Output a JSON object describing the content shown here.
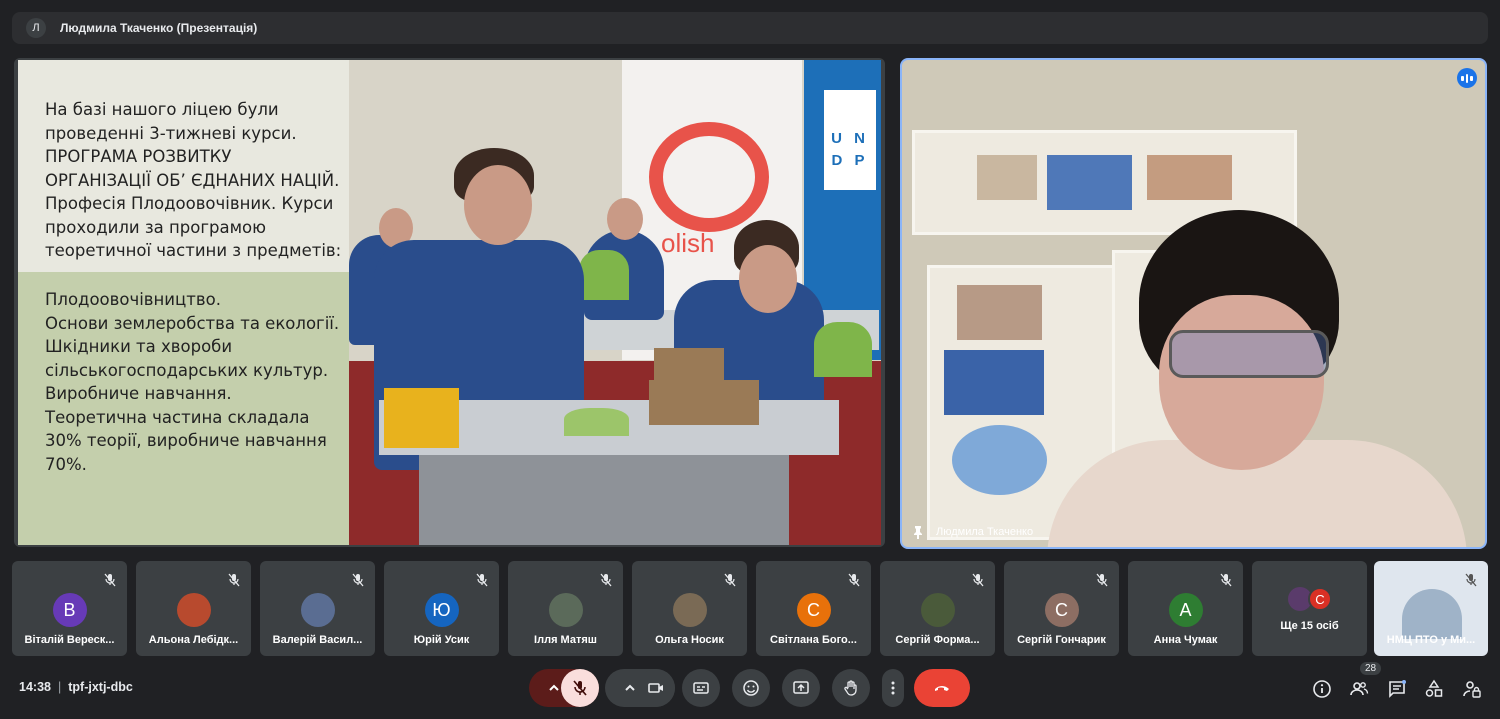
{
  "topbar": {
    "avatar_letter": "Л",
    "title": "Людмила Ткаченко (Презентація)"
  },
  "slide": {
    "text_top": "На базі нашого ліцею були\nпроведенні 3-тижневі  курси.\n      ПРОГРАМА РОЗВИТКУ\nОРГАНІЗАЦІЇ ОБ’ ЄДНАНИХ НАЦІЙ.\nПрофесія Плодоовочівник. Курси\nпроходили за програмою\nтеоретичної частини з предметів:",
    "text_bottom": "Плодоовочівництво.\nОснови землеробства та екології.\nШкідники та хвороби\nсільськогосподарських культур.\nВиробниче навчання.\n Теоретична частина складала\n30% теорії, виробниче навчання\n70%.",
    "photo_text": "olish",
    "undp_text": "U N\nD P"
  },
  "camera": {
    "name": "Людмила Ткаченко",
    "border_color": "#8ab4f8"
  },
  "participants": [
    {
      "name": "Віталій Верескун",
      "display": "Віталій Вереск...",
      "letter": "В",
      "color": "#673ab7"
    },
    {
      "name": "Альона Лебідка",
      "display": "Альона Лебідк...",
      "letter": "",
      "color": "#b84a2e"
    },
    {
      "name": "Валерій Василій",
      "display": "Валерій Васил...",
      "letter": "",
      "color": "#5a6d92"
    },
    {
      "name": "Юрій Усик",
      "display": "Юрій Усик",
      "letter": "Ю",
      "color": "#1565c0"
    },
    {
      "name": "Ілля Матяш",
      "display": "Ілля Матяш",
      "letter": "",
      "color": "#5b6a5a"
    },
    {
      "name": "Ольга Носик",
      "display": "Ольга Носик",
      "letter": "",
      "color": "#7a6a55"
    },
    {
      "name": "Світлана Богомолова",
      "display": "Світлана Бого...",
      "letter": "С",
      "color": "#e8710a"
    },
    {
      "name": "Сергій Формаль",
      "display": "Сергій Форма...",
      "letter": "",
      "color": "#4a5a3a"
    },
    {
      "name": "Сергій Гончарик",
      "display": "Сергій Гончарик",
      "letter": "С",
      "color": "#8d6e63"
    },
    {
      "name": "Анна Чумак",
      "display": "Анна Чумак",
      "letter": "А",
      "color": "#2e7d32"
    },
    {
      "name": "Ще 15 осіб",
      "display": "Ще 15 осіб",
      "letter": "С",
      "color": "#d93025"
    },
    {
      "name": "НМЦ ПТО у Миколаївській",
      "display": "НМЦ ПТО у Ми...",
      "letter": "",
      "color": "#9fb3c8"
    }
  ],
  "bottom": {
    "time": "14:38",
    "separator": "|",
    "meeting_code": "tpf-jxtj-dbc",
    "people_count": "28",
    "end_call_color": "#ea4335",
    "mic_off_color": "#f9dedc"
  }
}
